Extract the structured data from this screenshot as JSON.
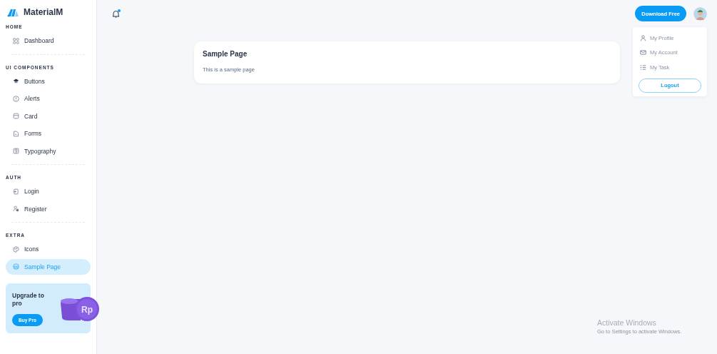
{
  "brand": {
    "name": "MaterialM"
  },
  "sidebar": {
    "sections": [
      {
        "title": "HOME",
        "items": [
          {
            "label": "Dashboard",
            "selected": false
          }
        ]
      },
      {
        "title": "UI COMPONENTS",
        "items": [
          {
            "label": "Buttons",
            "selected": false
          },
          {
            "label": "Alerts",
            "selected": false
          },
          {
            "label": "Card",
            "selected": false
          },
          {
            "label": "Forms",
            "selected": false
          },
          {
            "label": "Typography",
            "selected": false
          }
        ]
      },
      {
        "title": "AUTH",
        "items": [
          {
            "label": "Login",
            "selected": false
          },
          {
            "label": "Register",
            "selected": false
          }
        ]
      },
      {
        "title": "EXTRA",
        "items": [
          {
            "label": "Icons",
            "selected": false
          },
          {
            "label": "Sample Page",
            "selected": true
          }
        ]
      }
    ],
    "promo": {
      "title": "Upgrade to pro",
      "button": "Buy Pro",
      "coin_text": "Rp"
    }
  },
  "header": {
    "notification_dot": true,
    "download_button": "Download Free"
  },
  "profile_menu": {
    "items": [
      {
        "label": "My Profile"
      },
      {
        "label": "My Account"
      },
      {
        "label": "My Task"
      }
    ],
    "logout": "Logout"
  },
  "card": {
    "title": "Sample Page",
    "text": "This is a sample page"
  },
  "os_notice": {
    "title": "Activate Windows",
    "text": "Go to Settings to activate Windows."
  }
}
